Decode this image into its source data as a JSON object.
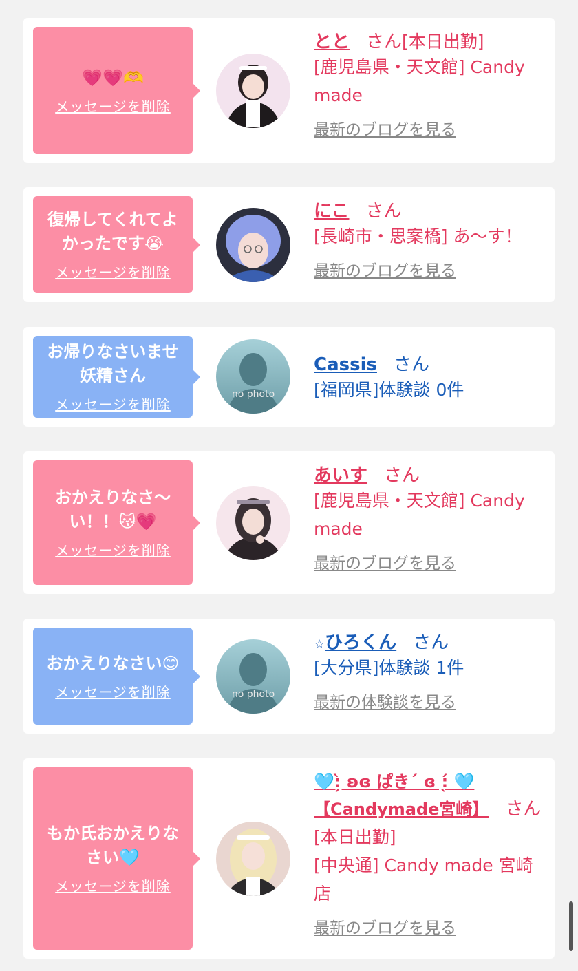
{
  "delete_label": "メッセージを削除",
  "san": "さん",
  "entries": [
    {
      "message_lines": [
        "💗💗🫶"
      ],
      "name": "とと",
      "name_suffix": "[本日出勤]",
      "lines": [
        "[鹿児島県・天文館] Candy",
        "made"
      ],
      "blog_link": "最新のブログを見る"
    },
    {
      "message_lines": [
        "復帰してくれてよ",
        "かったです😭"
      ],
      "name": "にこ",
      "lines": [
        "[長崎市・思案橋] あ～す！"
      ],
      "blog_link": "最新のブログを見る"
    },
    {
      "message_lines": [
        "お帰りなさいませ",
        "妖精さん"
      ],
      "name": "Cassis",
      "lines": [
        "[福岡県]体験談 0件"
      ],
      "avatar_text": "no photo"
    },
    {
      "message_lines": [
        "おかえりなさ〜",
        "い！！😽💗"
      ],
      "name": "あいす",
      "lines": [
        "[鹿児島県・天文館] Candy",
        "made"
      ],
      "blog_link": "最新のブログを見る"
    },
    {
      "message_lines": [
        "おかえりなさい😊"
      ],
      "name_prefix": "☆",
      "name": "ひろくん",
      "lines": [
        "[大分県]体験談 1件"
      ],
      "blog_link": "最新の体験談を見る",
      "avatar_text": "no photo"
    },
    {
      "message_lines": [
        "もか氏おかえりな",
        "さい🩵"
      ],
      "name_line1": "🩵:̗̀ ʚɞ ぱきˊ ɞ :̖́ 🩵",
      "name_line2": "【Candymade宮崎】",
      "lines": [
        "[本日出勤]",
        "[中央通] Candy made 宮崎",
        "店"
      ],
      "blog_link": "最新のブログを見る"
    }
  ],
  "colors": {
    "pink_bubble": "#fc8ea5",
    "blue_bubble": "#89b2f5",
    "cast_text": "#e3395e",
    "user_text": "#1a5db8",
    "link_gray": "#888888"
  }
}
